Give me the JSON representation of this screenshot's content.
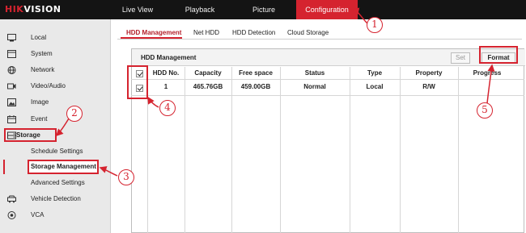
{
  "app": {
    "brand_prefix": "HIK",
    "brand_suffix": "VISION"
  },
  "nav": [
    {
      "label": "Live View"
    },
    {
      "label": "Playback"
    },
    {
      "label": "Picture"
    },
    {
      "label": "Configuration"
    }
  ],
  "sidebar": {
    "items": [
      {
        "label": "Local",
        "icon": "monitor-icon"
      },
      {
        "label": "System",
        "icon": "system-icon"
      },
      {
        "label": "Network",
        "icon": "network-icon"
      },
      {
        "label": "Video/Audio",
        "icon": "video-audio-icon"
      },
      {
        "label": "Image",
        "icon": "image-icon"
      },
      {
        "label": "Event",
        "icon": "event-icon"
      },
      {
        "label": "Storage",
        "icon": "storage-icon"
      },
      {
        "label": "Schedule Settings"
      },
      {
        "label": "Storage Management"
      },
      {
        "label": "Advanced Settings"
      },
      {
        "label": "Vehicle Detection",
        "icon": "vehicle-icon"
      },
      {
        "label": "VCA",
        "icon": "vca-icon"
      }
    ]
  },
  "tabs": [
    {
      "label": "HDD Management"
    },
    {
      "label": "Net HDD"
    },
    {
      "label": "HDD Detection"
    },
    {
      "label": "Cloud Storage"
    }
  ],
  "panel": {
    "title": "HDD Management",
    "set_label": "Set",
    "format_label": "Format",
    "columns": [
      "HDD No.",
      "Capacity",
      "Free space",
      "Status",
      "Type",
      "Property",
      "Progress"
    ],
    "rows": [
      {
        "hdd_no": "1",
        "capacity": "465.76GB",
        "free_space": "459.00GB",
        "status": "Normal",
        "type": "Local",
        "property": "R/W",
        "progress": ""
      }
    ]
  },
  "annotations": [
    "1",
    "2",
    "3",
    "4",
    "5"
  ],
  "colors": {
    "accent": "#d5232f",
    "topbar": "#141414",
    "sidebar": "#e9e9e9"
  }
}
